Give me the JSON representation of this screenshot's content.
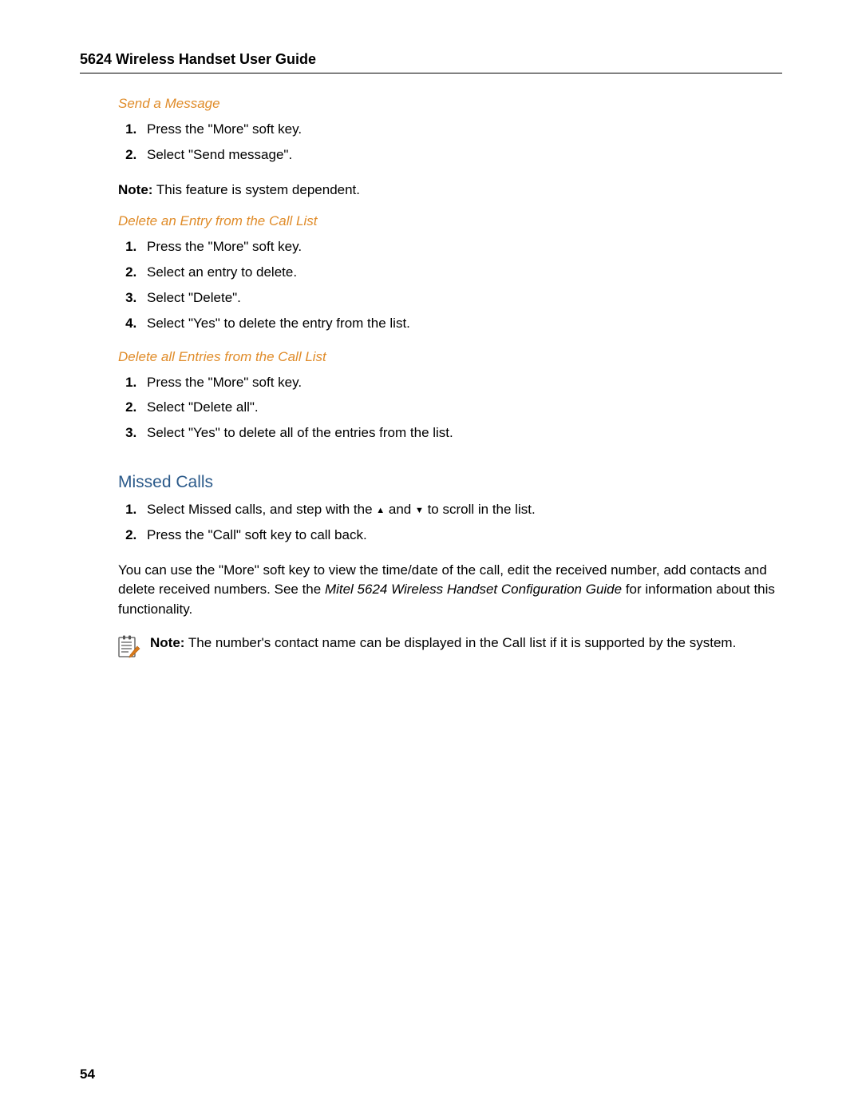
{
  "header": {
    "title": "5624 Wireless Handset User Guide"
  },
  "sections": {
    "send_message": {
      "heading": "Send a Message",
      "step1": "Press the \"More\" soft key.",
      "step2": "Select \"Send message\".",
      "note_label": "Note:",
      "note_text": " This feature is system dependent."
    },
    "delete_entry": {
      "heading": "Delete an Entry from the Call List",
      "step1": "Press the \"More\" soft key.",
      "step2": "Select an entry to delete.",
      "step3": "Select \"Delete\".",
      "step4": "Select \"Yes\" to delete the entry from the list."
    },
    "delete_all": {
      "heading": "Delete all Entries from the Call List",
      "step1": "Press the \"More\" soft key.",
      "step2": "Select \"Delete all\".",
      "step3": "Select \"Yes\" to delete all of the entries from the list."
    },
    "missed_calls": {
      "heading": "Missed Calls",
      "step1_prefix": "Select Missed calls, and step with the ",
      "step1_mid": " and ",
      "step1_suffix": " to scroll in the list.",
      "step2": "Press the \"Call\" soft key to call back.",
      "para_part1": "You can use the \"More\" soft key to view the time/date of the call, edit the received number, add contacts and delete received numbers. See the ",
      "para_italic": "Mitel 5624 Wireless Handset Configuration Guide",
      "para_part2": " for information about this functionality.",
      "note_label": "Note:",
      "note_text": " The number's contact name can be displayed in the Call list if it is supported by the system."
    }
  },
  "page_number": "54",
  "icons": {
    "up": "▲",
    "down": "▼"
  }
}
